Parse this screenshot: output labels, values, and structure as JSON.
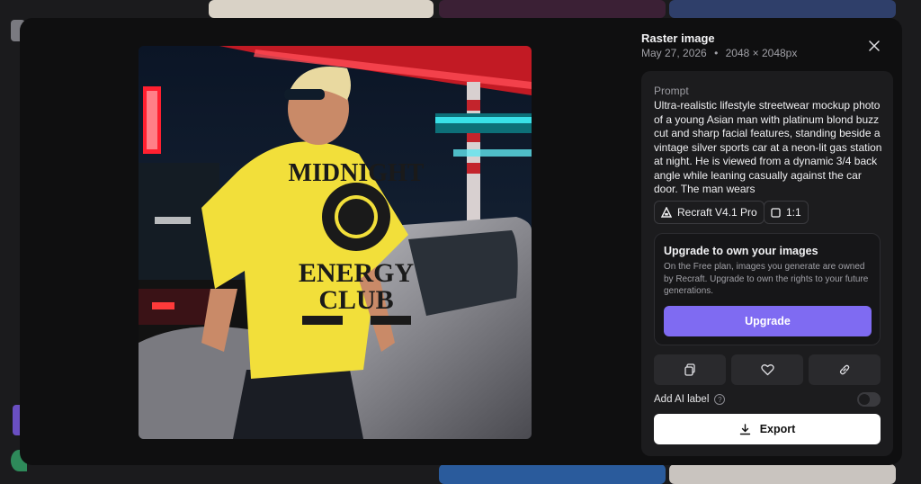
{
  "panel": {
    "title": "Raster image",
    "date": "May 27, 2026",
    "separator": "•",
    "dimensions": "2048 × 2048px"
  },
  "prompt": {
    "label": "Prompt",
    "text": "Ultra-realistic lifestyle streetwear mockup photo of a young Asian man with platinum blond buzz cut and sharp facial features, standing beside a vintage silver sports car at a neon-lit gas station at night. He is viewed from a dynamic 3/4 back angle while leaning casually against the car door. The man wears"
  },
  "chips": {
    "model": "Recraft V4.1 Pro",
    "ratio": "1:1"
  },
  "upgrade": {
    "title": "Upgrade to own your images",
    "description": "On the Free plan, images you generate are owned by Recraft. Upgrade to own the rights to your future generations.",
    "button": "Upgrade"
  },
  "ai_label": {
    "label": "Add AI label",
    "help": "?",
    "enabled": false
  },
  "export": {
    "label": "Export"
  },
  "shirt": {
    "line1": "MIDNIGHT",
    "line2": "ENERGY",
    "line3": "CLUB"
  },
  "icons": {
    "close": "close-icon",
    "copy": "copy-icon",
    "like": "heart-icon",
    "link": "link-icon",
    "download": "download-icon"
  },
  "colors": {
    "accent": "#7f6bf2",
    "modal_bg": "#0f0f10",
    "card_bg": "#1c1c1e"
  }
}
